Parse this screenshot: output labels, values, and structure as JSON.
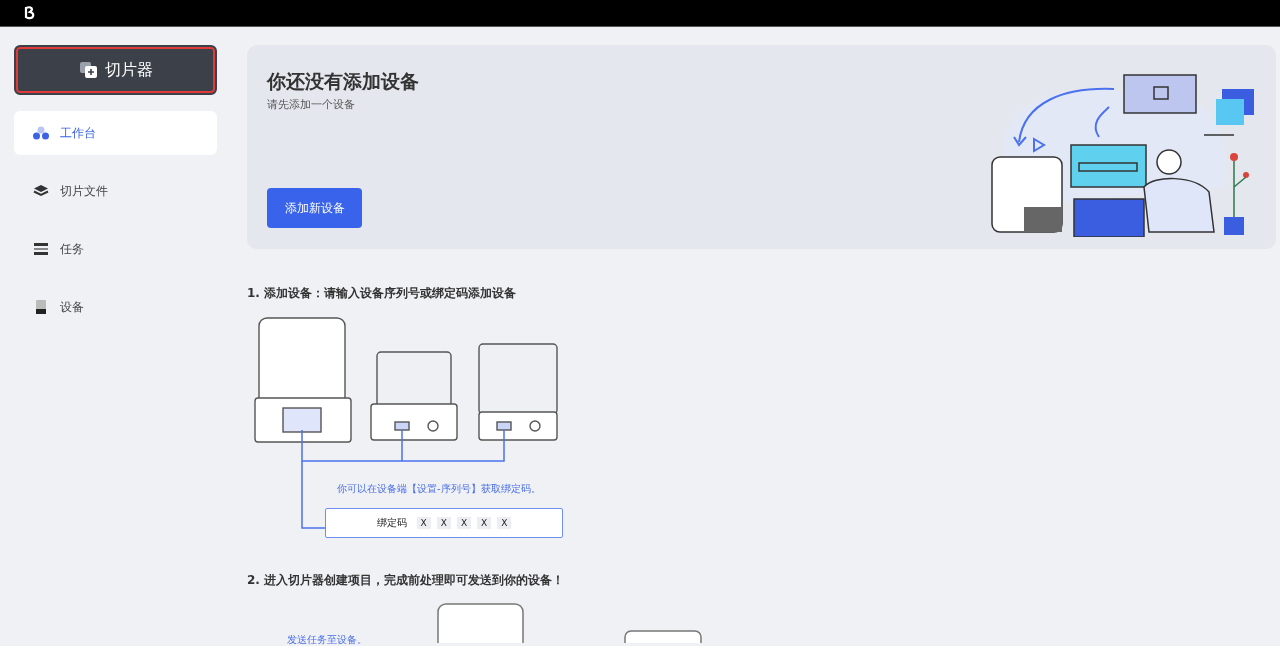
{
  "slicer_button": {
    "label": "切片器",
    "highlighted": true
  },
  "sidebar": {
    "items": [
      {
        "label": "工作台",
        "selected": true
      },
      {
        "label": "切片文件",
        "selected": false
      },
      {
        "label": "任务",
        "selected": false
      },
      {
        "label": "设备",
        "selected": false
      }
    ]
  },
  "banner": {
    "title": "你还没有添加设备",
    "subtitle": "请先添加一个设备",
    "button": "添加新设备"
  },
  "step_1": {
    "title": "1. 添加设备：请输入设备序列号或绑定码添加设备",
    "hint": "你可以在设备端【设置-序列号】获取绑定码。",
    "bind_field": {
      "label": "绑定码",
      "slots": [
        "X",
        "X",
        "X",
        "X",
        "X"
      ]
    }
  },
  "step_2": {
    "title": "2. 进入切片器创建项目，完成前处理即可发送到你的设备！",
    "hint": "发送任务至设备。"
  }
}
